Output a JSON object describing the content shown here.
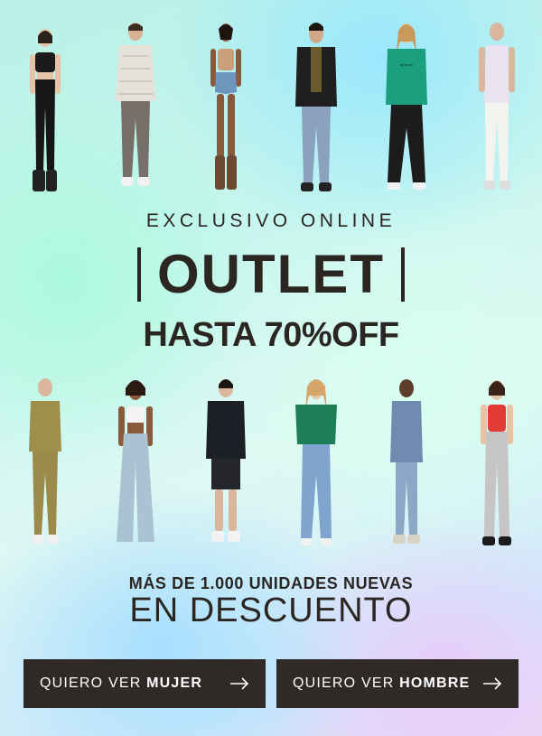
{
  "colors": {
    "text": "#2b2622",
    "button_bg": "#2f2a27",
    "button_text": "#ffffff"
  },
  "top_models": [
    {
      "id": "model-1",
      "icon": "woman-black-outfit"
    },
    {
      "id": "model-2",
      "icon": "man-puffer-jacket"
    },
    {
      "id": "model-3",
      "icon": "woman-denim-shorts"
    },
    {
      "id": "model-4",
      "icon": "man-leather-jacket"
    },
    {
      "id": "model-5",
      "icon": "woman-green-sweatshirt"
    },
    {
      "id": "model-6",
      "icon": "man-white-outfit"
    }
  ],
  "bottom_models": [
    {
      "id": "model-7",
      "icon": "man-khaki-set"
    },
    {
      "id": "model-8",
      "icon": "woman-wide-jeans"
    },
    {
      "id": "model-9",
      "icon": "man-black-shorts"
    },
    {
      "id": "model-10",
      "icon": "woman-green-sweater"
    },
    {
      "id": "model-11",
      "icon": "man-denim-jacket"
    },
    {
      "id": "model-12",
      "icon": "woman-red-top"
    }
  ],
  "promo": {
    "kicker": "EXCLUSIVO ONLINE",
    "title": "OUTLET",
    "discount": "HASTA 70%OFF"
  },
  "footer": {
    "line1": "MÁS DE 1.000 UNIDADES NUEVAS",
    "line2": "EN DESCUENTO"
  },
  "buttons": {
    "women_prefix": "QUIERO VER ",
    "women_bold": "MUJER",
    "men_prefix": "QUIERO VER ",
    "men_bold": "HOMBRE",
    "arrow_icon": "arrow-right-icon"
  }
}
